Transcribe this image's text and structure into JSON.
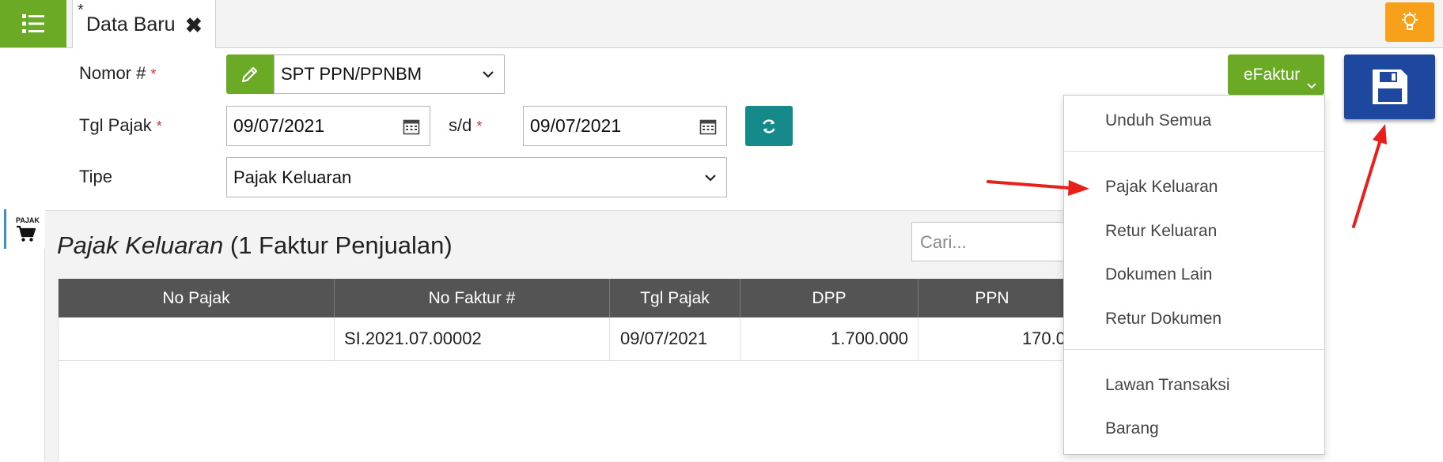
{
  "tab": {
    "modified_marker": "*",
    "title": "Data Baru"
  },
  "form": {
    "nomor_label": "Nomor #",
    "tgl_label": "Tgl Pajak",
    "tipe_label": "Tipe",
    "required_marker": "*",
    "sd_label": "s/d",
    "nomor_value": "SPT PPN/PPNBM",
    "date_from": "09/07/2021",
    "date_to": "09/07/2021",
    "tipe_value": "Pajak Keluaran"
  },
  "efaktur": {
    "label": "eFaktur",
    "items": [
      "Unduh Semua",
      "Pajak Keluaran",
      "Retur Keluaran",
      "Dokumen Lain",
      "Retur Dokumen",
      "Lawan Transaksi",
      "Barang"
    ]
  },
  "section": {
    "side_tab_label": "PAJAK",
    "title_italic": "Pajak Keluaran",
    "title_count": "(1 Faktur Penjualan)",
    "search_placeholder": "Cari..."
  },
  "table": {
    "headers": [
      "No Pajak",
      "No Faktur #",
      "Tgl Pajak",
      "DPP",
      "PPN"
    ],
    "rows": [
      {
        "no_pajak": "",
        "no_faktur": "SI.2021.07.00002",
        "tgl_pajak": "09/07/2021",
        "dpp": "1.700.000",
        "ppn": "170.0"
      }
    ]
  },
  "colors": {
    "green": "#6aaa25",
    "teal": "#168a8a",
    "orange": "#f7a11a",
    "save_blue": "#1e48a0",
    "header_gray": "#545454",
    "required_red": "#d9302f",
    "annotation_red": "#e8201a"
  },
  "icons": [
    "menu-list-icon",
    "close-icon",
    "lightbulb-icon",
    "pencil-icon",
    "chevron-down-icon",
    "calendar-icon",
    "refresh-icon",
    "save-icon",
    "cart-icon"
  ]
}
